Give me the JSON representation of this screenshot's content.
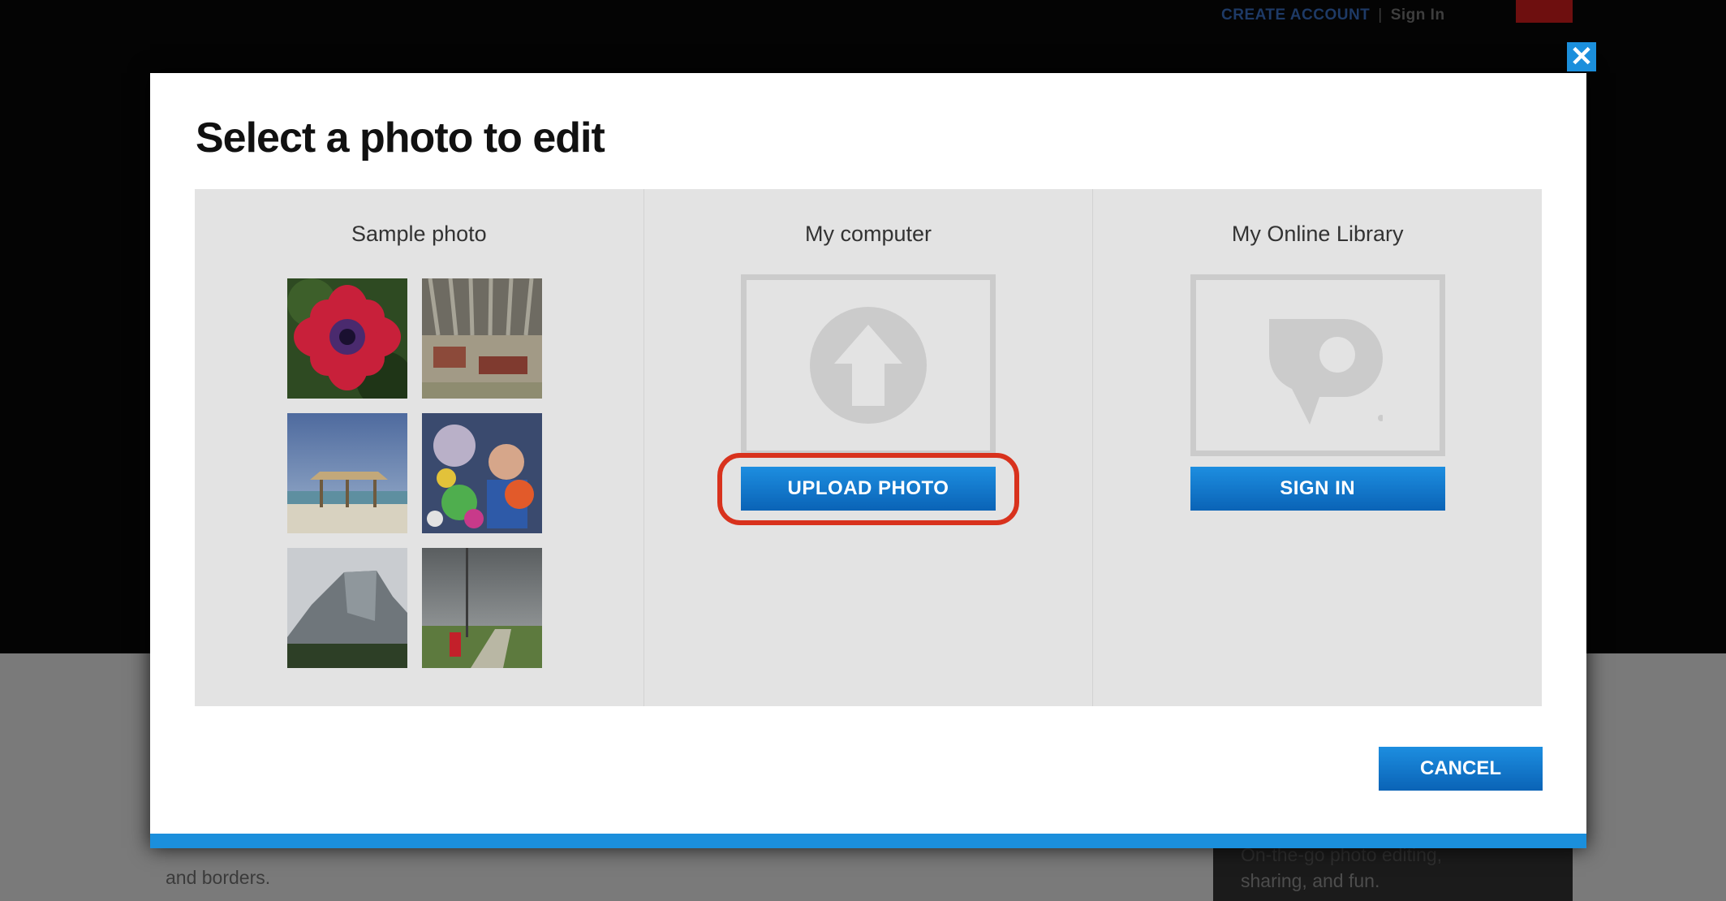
{
  "background": {
    "top_links": {
      "create_account": "CREATE ACCOUNT",
      "separator": "|",
      "sign_in": "Sign In"
    },
    "left_text": "and borders.",
    "promo": {
      "line1": "On-the-go photo editing,",
      "line2": "sharing, and fun."
    }
  },
  "modal": {
    "close_glyph": "✕",
    "title": "Select a photo to edit",
    "columns": {
      "sample": {
        "title": "Sample photo"
      },
      "computer": {
        "title": "My computer",
        "button": "UPLOAD PHOTO"
      },
      "library": {
        "title": "My Online Library",
        "button": "SIGN IN"
      }
    },
    "cancel": "CANCEL"
  },
  "icons": [
    "upload-arrow-icon",
    "photoshop-express-logo-icon",
    "close-icon"
  ],
  "colors": {
    "accent": "#1b8fdc",
    "highlight": "#d8321d",
    "panel": "#e3e3e3"
  }
}
